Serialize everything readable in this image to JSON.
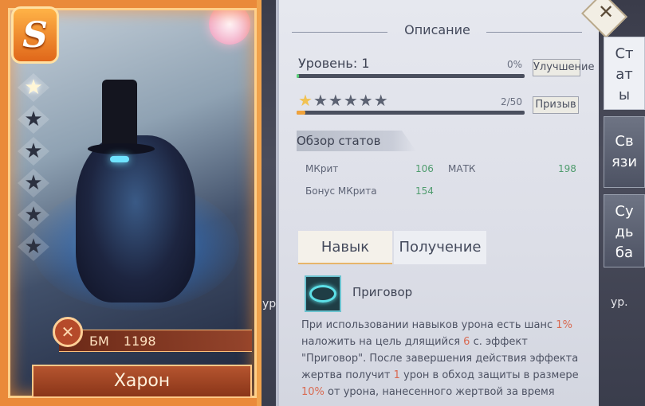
{
  "hero": {
    "rank": "S",
    "bm_label": "БМ",
    "bm_value": "1198",
    "name": "Харон",
    "star_count": 1,
    "star_total": 6
  },
  "panel": {
    "title": "Описание",
    "level_label": "Уровень: 1",
    "level_percent": "0%",
    "level_progress": 0.01,
    "upgrade_button": "Улучшение",
    "star_progress_text": "2/50",
    "star_progress": 0.04,
    "summon_button": "Призыв",
    "stats_overview": "Обзор статов",
    "stats": [
      {
        "name": "МКрит",
        "value": "106"
      },
      {
        "name": "МАТК",
        "value": "198"
      },
      {
        "name": "Бонус МКрита",
        "value": "154"
      }
    ],
    "tabs": {
      "skill": "Навык",
      "obtain": "Получение"
    },
    "skill": {
      "name": "Приговор",
      "desc": {
        "p1": "При использовании навыков урона есть шанс ",
        "v1": "1%",
        "p2": "наложить на цель длящийся ",
        "v2": "6",
        "p3": " с. эффект",
        "p4": "\"Приговор\". После завершения действия эффекта",
        "p5": "жертва получит ",
        "v3": "1",
        "p6": " урон в обход защиты в размере",
        "v4": "10%",
        "p7": " от урона, нанесенного жертвой за время"
      }
    }
  },
  "side_tabs": {
    "stats": [
      "Ст",
      "ат",
      "ы"
    ],
    "links": [
      "Св",
      "язи"
    ],
    "fate": [
      "Су",
      "дь",
      "ба"
    ]
  },
  "background": {
    "ur_left": "ур.",
    "ur_right": "ур."
  },
  "colors": {
    "accent": "#f1c253",
    "highlight": "#d96a52",
    "stat_value": "#4f9c6e"
  }
}
